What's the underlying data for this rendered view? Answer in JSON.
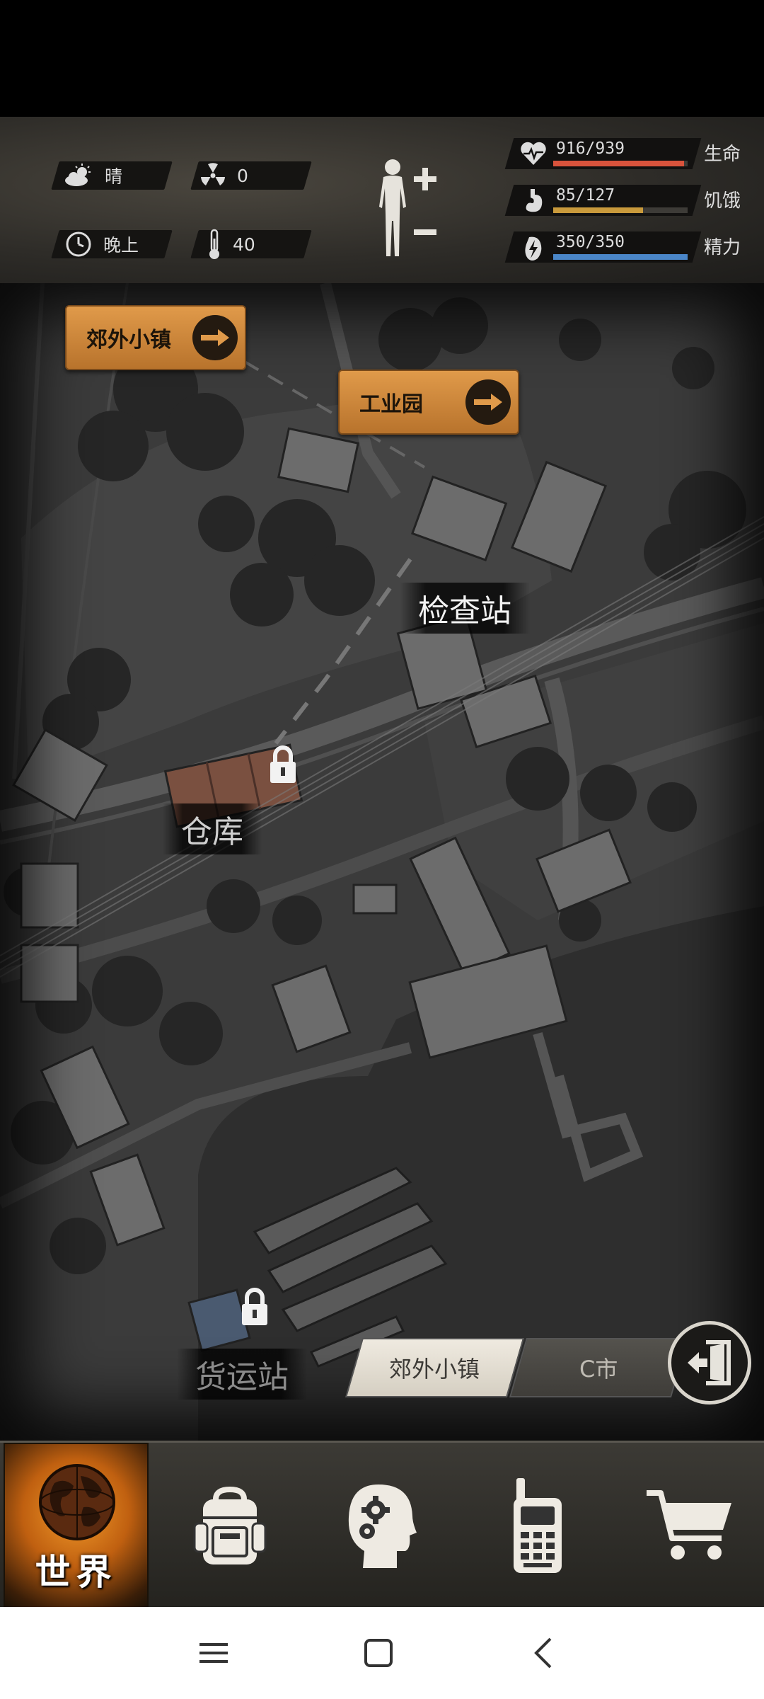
{
  "hud": {
    "weather": "晴",
    "radiation": "0",
    "time_of_day": "晚上",
    "temperature": "40",
    "stats": [
      {
        "value": "916/939",
        "label": "生命",
        "fraction": 0.975,
        "color": "#d9533c"
      },
      {
        "value": "85/127",
        "label": "饥饿",
        "fraction": 0.67,
        "color": "#c99a3c"
      },
      {
        "value": "350/350",
        "label": "精力",
        "fraction": 1.0,
        "color": "#4a86c8"
      }
    ]
  },
  "map": {
    "nav_buttons": [
      {
        "label": "郊外小镇"
      },
      {
        "label": "工业园"
      }
    ],
    "locations": {
      "checkpoint": "检查站",
      "warehouse": "仓库",
      "freight_station": "货运站"
    }
  },
  "regions": {
    "active": "郊外小镇",
    "other": "C市"
  },
  "nav": {
    "world_label": "世界"
  },
  "icons": {
    "weather": "cloud-sun-icon",
    "radiation": "radiation-icon",
    "time": "clock-icon",
    "temperature": "thermometer-icon",
    "health": "heart-icon",
    "hunger": "stomach-icon",
    "energy": "lightning-icon"
  }
}
